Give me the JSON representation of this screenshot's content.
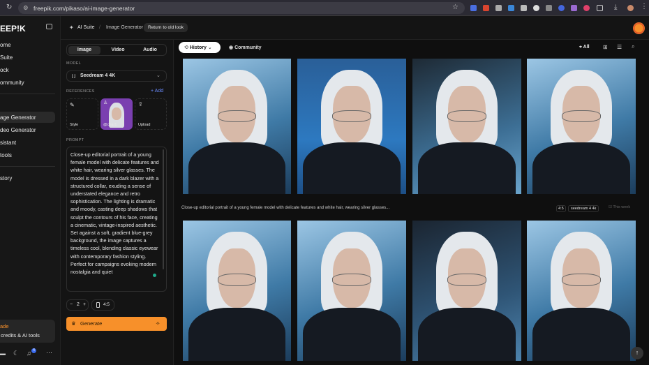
{
  "browser": {
    "url": "freepik.com/pikaso/ai-image-generator"
  },
  "sidebar": {
    "logo": "EEP!K",
    "items": [
      {
        "label": "ome"
      },
      {
        "label": "Suite"
      },
      {
        "label": "ock"
      },
      {
        "label": "ommunity"
      },
      {
        "label": "age Generator"
      },
      {
        "label": "deo Generator"
      },
      {
        "label": "sistant"
      },
      {
        "label": "tools"
      },
      {
        "label": "story"
      }
    ],
    "upgrade": {
      "title": "ade",
      "subtitle": "credits & AI tools"
    },
    "notification_count": "4"
  },
  "header": {
    "breadcrumb": [
      "AI Suite",
      "Image Generator"
    ],
    "return_button": "Return to old look"
  },
  "panel": {
    "tabs": [
      "Image",
      "Video",
      "Audio"
    ],
    "model_label": "MODEL",
    "model_value": "Seedream 4 4K",
    "references_label": "REFERENCES",
    "add_label": "Add",
    "references": [
      {
        "label": "Style"
      },
      {
        "label": "@char1"
      },
      {
        "label": "Upload"
      }
    ],
    "prompt_label": "PROMPT",
    "prompt": "Close-up editorial portrait of a young female model with delicate features and white hair, wearing silver glasses. The model is dressed in a dark blazer with a structured collar, exuding a sense of understated elegance and retro sophistication. The lighting is dramatic and moody, casting deep shadows that sculpt the contours of his face, creating a cinematic, vintage-inspired aesthetic. Set against a soft, gradient blue-grey background, the image captures a timeless cool, blending classic eyewear with contemporary fashion styling. Perfect for campaigns evoking modern nostalgia and quiet",
    "count": "2",
    "ratio": "4:5",
    "generate": "Generate"
  },
  "gallery": {
    "history": "History",
    "community": "Community",
    "filter": "All",
    "caption": "Close-up editorial portrait of a young female model with delicate features and white hair, wearing silver glasses...",
    "ratio_tag": "4:5",
    "model_tag": "seedream 4 4k",
    "date": "This week"
  },
  "colors": {
    "accent": "#f7902a",
    "link": "#6b8cff"
  }
}
